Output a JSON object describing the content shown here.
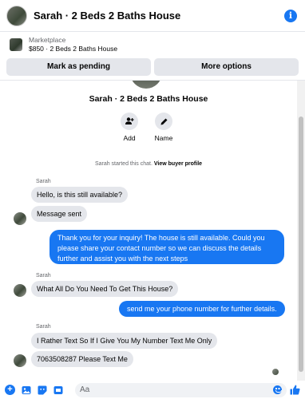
{
  "header": {
    "title": "Sarah · 2 Beds 2 Baths House",
    "info_icon": "info-icon"
  },
  "marketplace": {
    "label": "Marketplace",
    "listing": "$850 · 2 Beds 2 Baths House",
    "pending_button": "Mark as pending",
    "more_button": "More options"
  },
  "chat": {
    "title": "Sarah · 2 Beds 2 Baths House",
    "actions": [
      {
        "label": "Add",
        "icon": "add-person-icon"
      },
      {
        "label": "Name",
        "icon": "pencil-icon"
      }
    ],
    "started_prefix": "Sarah started this chat.",
    "started_link": "View buyer profile",
    "messages": [
      {
        "sender": "Sarah",
        "text": "Hello, is this still available?"
      },
      {
        "text": "Message sent"
      },
      {
        "text": "Thank you for your inquiry! The house is still available. Could you please share your contact number so we can discuss the details further and assist you with the next steps"
      },
      {
        "sender": "Sarah",
        "text": "What All Do You Need To Get This House?"
      },
      {
        "text": "send me your phone number for further details."
      },
      {
        "sender": "Sarah",
        "text": "I Rather Text So If I Give You My Number Text Me Only"
      },
      {
        "text": "7063508287 Please Text Me"
      }
    ]
  },
  "composer": {
    "placeholder": "Aa",
    "icons": [
      "plus-icon",
      "image-icon",
      "sticker-icon",
      "gif-icon",
      "emoji-icon",
      "like-icon"
    ]
  },
  "colors": {
    "accent": "#1877f2",
    "bubble_in": "#e4e6eb"
  }
}
